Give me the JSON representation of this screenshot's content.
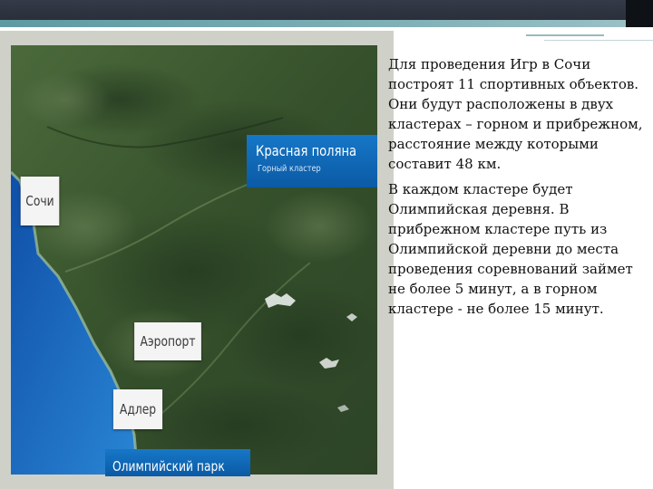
{
  "slide": {
    "paragraphs": [
      "Для проведения Игр в Сочи построят 11 спортивных объектов. Они будут расположены в двух кластерах – горном и прибрежном, расстояние между которыми составит 48 км.",
      "В каждом кластере будет Олимпийская деревня. В прибрежном кластере путь из Олимпийской деревни до места проведения соревнований займет не более 5 минут, а в горном кластере - не более 15 минут."
    ]
  },
  "map": {
    "labels": {
      "sochi": "Сочи",
      "airport": "Аэропорт",
      "adler": "Адлер",
      "krasnaya_polyana": "Красная поляна",
      "mountain_cluster": "Горный кластер",
      "olympic_park": "Олимпийский парк"
    }
  },
  "colors": {
    "sea": "#1a5fb3",
    "land": "#3f5a32",
    "banner": "#1677c7",
    "accent": "#7fb0b6"
  }
}
